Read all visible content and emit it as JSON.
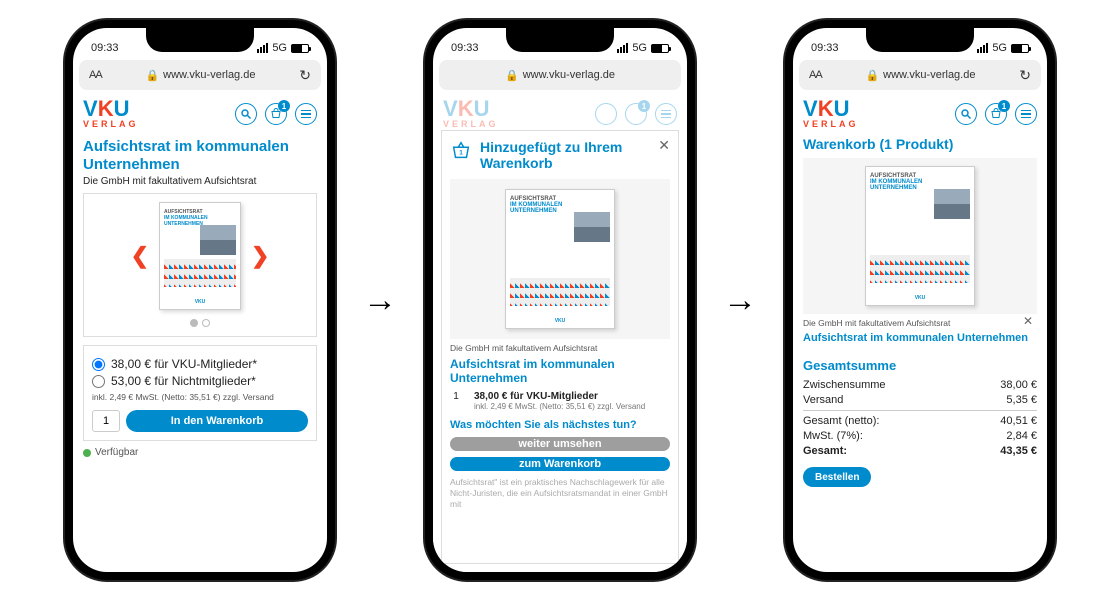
{
  "status": {
    "time": "09:33",
    "net": "5G"
  },
  "url": "www.vku-verlag.de",
  "logo": {
    "brand_pre": "V",
    "brand_mid": "K",
    "brand_post": "U",
    "sub": "VERLAG"
  },
  "header": {
    "cart_badge": "1"
  },
  "product": {
    "title": "Aufsichtsrat im kommunalen Unternehmen",
    "subtitle": "Die GmbH mit fakultativem Aufsichtsrat",
    "cover_line1": "AUFSICHTSRAT",
    "cover_line2": "IM KOMMUNALEN",
    "cover_line3": "UNTERNEHMEN",
    "opt_member": "38,00 € für VKU-Mitglieder*",
    "opt_nonmember": "53,00 € für Nichtmitglieder*",
    "fine": "inkl. 2,49 € MwSt. (Netto: 35,51 €) zzgl. Versand",
    "qty": "1",
    "add_btn": "In den Warenkorb",
    "avail": "Verfügbar"
  },
  "modal": {
    "title": "Hinzugefügt zu Ihrem Warenkorb",
    "sub": "Die GmbH mit fakultativem Aufsichtsrat",
    "name": "Aufsichtsrat im kommunalen Unternehmen",
    "qty": "1",
    "price": "38,00 € für VKU-Mitglieder",
    "fine": "inkl. 2,49 € MwSt. (Netto: 35,51 €) zzgl. Versand",
    "next_q": "Was möchten Sie als nächstes tun?",
    "btn_continue": "weiter umsehen",
    "btn_cart": "zum Warenkorb",
    "ghost": "Aufsichtsrat\" ist ein praktisches Nachschlagewerk für alle Nicht-Juristen, die ein Aufsichtsratsmandat in einer GmbH mit"
  },
  "cart": {
    "title": "Warenkorb (1 Produkt)",
    "sub": "Die GmbH mit fakultativem Aufsichtsrat",
    "name": "Aufsichtsrat im kommunalen Unternehmen",
    "sum_title": "Gesamtsumme",
    "rows": {
      "sub_l": "Zwischensumme",
      "sub_v": "38,00 €",
      "ship_l": "Versand",
      "ship_v": "5,35 €",
      "net_l": "Gesamt (netto):",
      "net_v": "40,51 €",
      "vat_l": "MwSt. (7%):",
      "vat_v": "2,84 €",
      "tot_l": "Gesamt:",
      "tot_v": "43,35 €"
    },
    "order_btn": "Bestellen"
  }
}
